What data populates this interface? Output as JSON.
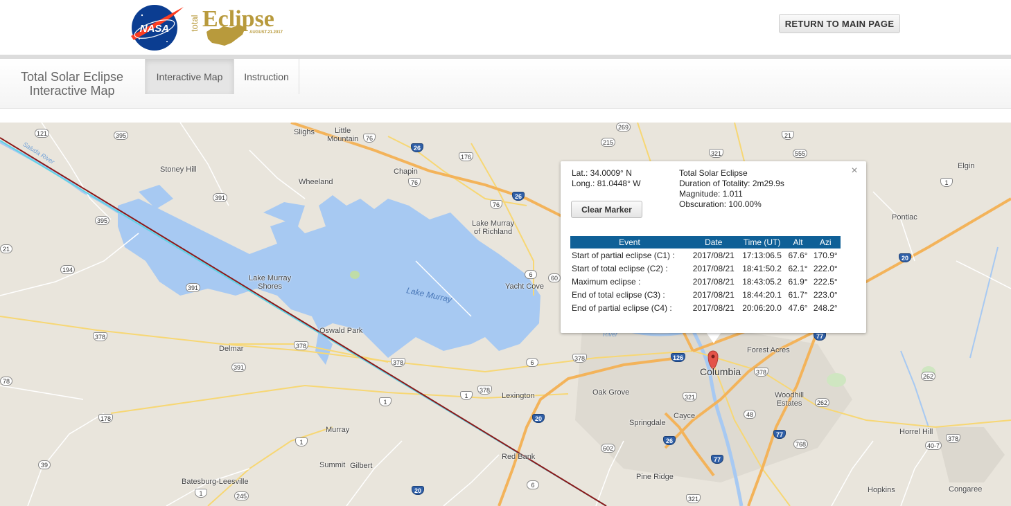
{
  "header": {
    "nasa_logo_text": "NASA",
    "eclipse_logo": {
      "prefix": "total",
      "word": "Eclipse",
      "date": "AUGUST.21.2017"
    },
    "return_button": "RETURN TO MAIN PAGE"
  },
  "nav": {
    "brand_line1": "Total Solar Eclipse",
    "brand_line2": "Interactive Map",
    "tabs": [
      {
        "label": "Interactive Map",
        "active": true
      },
      {
        "label": "Instruction",
        "active": false
      }
    ]
  },
  "popup": {
    "close_glyph": "×",
    "lat": "Lat.: 34.0009° N",
    "long": "Long.: 81.0448° W",
    "clear_button": "Clear Marker",
    "info": {
      "title": "Total Solar Eclipse",
      "duration": "Duration of Totality: 2m29.9s",
      "magnitude": "Magnitude: 1.011",
      "obscuration": "Obscuration: 100.00%"
    },
    "table": {
      "headers": [
        "Event",
        "Date",
        "Time (UT)",
        "Alt",
        "Azi"
      ],
      "rows": [
        [
          "Start of partial eclipse (C1) :",
          "2017/08/21",
          "17:13:06.5",
          "67.6°",
          "170.9°"
        ],
        [
          "Start of total eclipse (C2) :",
          "2017/08/21",
          "18:41:50.2",
          "62.1°",
          "222.0°"
        ],
        [
          "Maximum eclipse :",
          "2017/08/21",
          "18:43:05.2",
          "61.9°",
          "222.5°"
        ],
        [
          "End of total eclipse (C3) :",
          "2017/08/21",
          "18:44:20.1",
          "61.7°",
          "223.0°"
        ],
        [
          "End of partial eclipse (C4) :",
          "2017/08/21",
          "20:06:20.0",
          "47.6°",
          "248.2°"
        ]
      ]
    }
  },
  "map": {
    "colors": {
      "land": "#e9e5dc",
      "water": "#a7c9f2",
      "path_line": "#8b1a1a",
      "limit_line": "#5fd3e6",
      "marker": "#e4544a",
      "interstate": "#2f5fa7"
    },
    "places": {
      "sligh": "Slighs",
      "little_mountain_1": "Little",
      "little_mountain_2": "Mountain",
      "stoney_hill": "Stoney Hill",
      "chapin": "Chapin",
      "wheeland": "Wheeland",
      "lake_murray_richland_1": "Lake Murray",
      "lake_murray_richland_2": "of Richland",
      "lake_murray_shores_1": "Lake Murray",
      "lake_murray_shores_2": "Shores",
      "yacht_cove": "Yacht Cove",
      "lake_murray": "Lake Murray",
      "oswald_park": "Oswald Park",
      "delmar": "Delmar",
      "lexington": "Lexington",
      "oak_grove": "Oak Grove",
      "columbia": "Columbia",
      "forest_acres": "Forest Acres",
      "woodhill_1": "Woodhill",
      "woodhill_2": "Estates",
      "springdale": "Springdale",
      "cayce": "Cayce",
      "murray": "Murray",
      "summit": "Summit",
      "gilbert": "Gilbert",
      "red_bank": "Red Bank",
      "pine_ridge": "Pine Ridge",
      "batesburg": "Batesburg-Leesville",
      "horrel_hill": "Horrel Hill",
      "hopkins": "Hopkins",
      "congaree": "Congaree",
      "pontiac": "Pontiac",
      "elgin": "Elgin",
      "saluda_river": "Saluda River",
      "river": "River"
    },
    "shields": {
      "s121": "121",
      "s395a": "395",
      "s395b": "395",
      "s391a": "391",
      "s391b": "391",
      "s391c": "391",
      "s194": "194",
      "s21": "21",
      "s378a": "378",
      "s378b": "378",
      "s378c": "378",
      "s378d": "378",
      "s378e": "378",
      "s378f": "378",
      "s178": "178",
      "s78": "78",
      "s39": "39",
      "s245": "245",
      "s1a": "1",
      "s1b": "1",
      "s1c": "1",
      "s1d": "1",
      "s1e": "1",
      "s6a": "6",
      "s6b": "6",
      "s6c": "6",
      "s60": "60",
      "s76a": "76",
      "s76b": "76",
      "s76c": "76",
      "s176": "176",
      "s269": "269",
      "s215": "215",
      "s321a": "321",
      "s321b": "321",
      "s321c": "321",
      "s21b": "21",
      "s555": "555",
      "s48": "48",
      "s602": "602",
      "s768": "768",
      "s262a": "262",
      "s262b": "262",
      "s40": "40-7",
      "s378g": "378",
      "s76d": "76",
      "i26a": "26",
      "i26b": "26",
      "i26c": "26",
      "i20a": "20",
      "i20b": "20",
      "i20c": "20",
      "i77a": "77",
      "i77b": "77",
      "i77c": "77",
      "i126": "126"
    }
  }
}
